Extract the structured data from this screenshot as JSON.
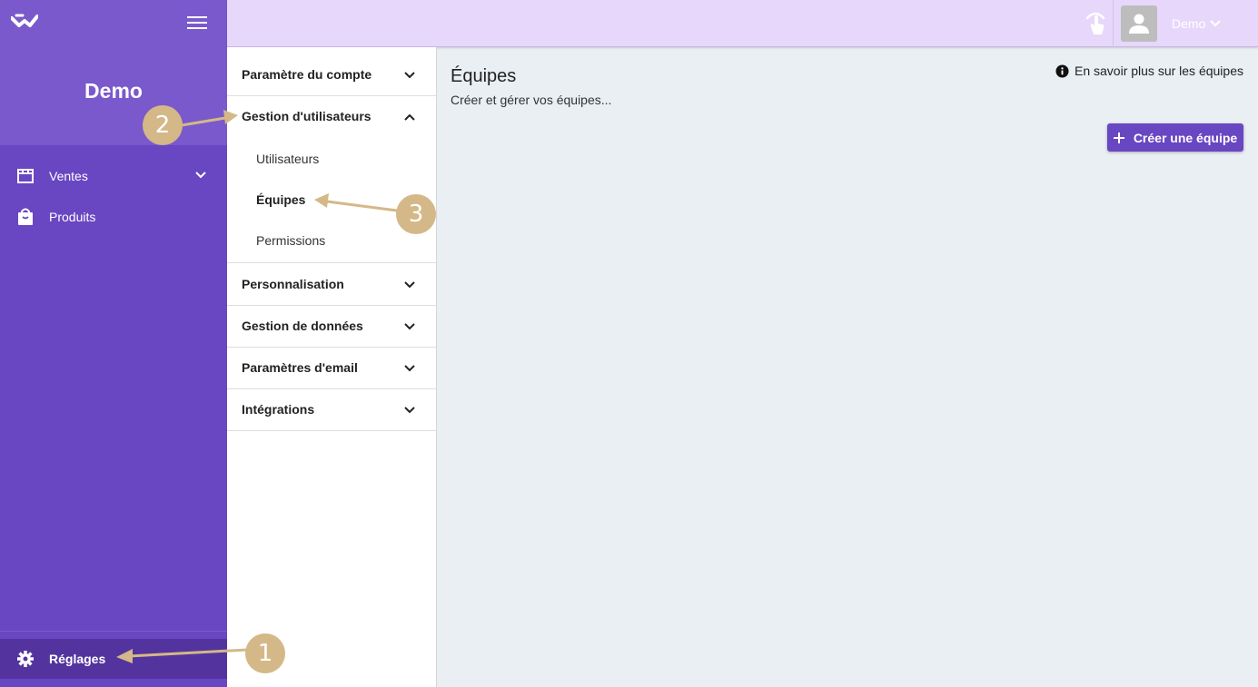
{
  "sidebar": {
    "brand": "Demo",
    "items": [
      {
        "label": "Ventes",
        "icon": "store-icon"
      },
      {
        "label": "Produits",
        "icon": "shopping-bag-icon"
      }
    ],
    "settings_label": "Réglages"
  },
  "topbar": {
    "user_name": "Demo"
  },
  "submenu": {
    "sections": [
      {
        "label": "Paramètre du compte",
        "expanded": false
      },
      {
        "label": "Gestion d'utilisateurs",
        "expanded": true,
        "items": [
          "Utilisateurs",
          "Équipes",
          "Permissions"
        ],
        "active_item": "Équipes"
      },
      {
        "label": "Personnalisation",
        "expanded": false
      },
      {
        "label": "Gestion de données",
        "expanded": false
      },
      {
        "label": "Paramètres d'email",
        "expanded": false
      },
      {
        "label": "Intégrations",
        "expanded": false
      }
    ]
  },
  "main": {
    "title": "Équipes",
    "subtitle": "Créer et gérer vos équipes...",
    "learn_more": "En savoir plus sur les équipes",
    "create_button": "Créer une équipe"
  },
  "annotations": [
    "1",
    "2",
    "3"
  ],
  "colors": {
    "sidebar": "#6946c2",
    "sidebar_top": "#7a59cc",
    "settings_active": "#53349f",
    "topbar": "#e7d7fb",
    "accent": "#6946c2",
    "callout": "#d4b887",
    "content_bg": "#eaeff3"
  }
}
